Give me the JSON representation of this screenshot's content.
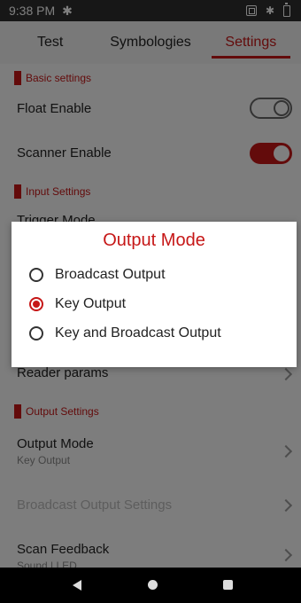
{
  "status_bar": {
    "time": "9:38 PM",
    "left_icon": "gear-icon",
    "right_icons": [
      "screenshot-icon",
      "bluetooth-icon",
      "battery-icon"
    ]
  },
  "tabs": [
    {
      "label": "Test",
      "active": false
    },
    {
      "label": "Symbologies",
      "active": false
    },
    {
      "label": "Settings",
      "active": true
    }
  ],
  "settings": {
    "basic_settings_header": "Basic settings",
    "float_enable": {
      "label": "Float Enable",
      "enabled": false
    },
    "scanner_enable": {
      "label": "Scanner Enable",
      "enabled": true
    },
    "input_settings_header": "Input Settings",
    "trigger_mode": {
      "label": "Trigger Mode"
    },
    "reader_params": {
      "label": "Reader params"
    },
    "output_settings_header": "Output Settings",
    "output_mode": {
      "label": "Output Mode",
      "value": "Key Output"
    },
    "broadcast_output_settings": {
      "label": "Broadcast Output Settings"
    },
    "scan_feedback": {
      "label": "Scan Feedback",
      "value": "Sound | LED"
    }
  },
  "dialog": {
    "title": "Output Mode",
    "options": [
      {
        "label": "Broadcast Output",
        "selected": false
      },
      {
        "label": "Key Output",
        "selected": true
      },
      {
        "label": "Key and Broadcast Output",
        "selected": false
      }
    ]
  },
  "colors": {
    "accent": "#c61717",
    "status_bar": "#2f2f2f",
    "nav_bar": "#000000"
  }
}
